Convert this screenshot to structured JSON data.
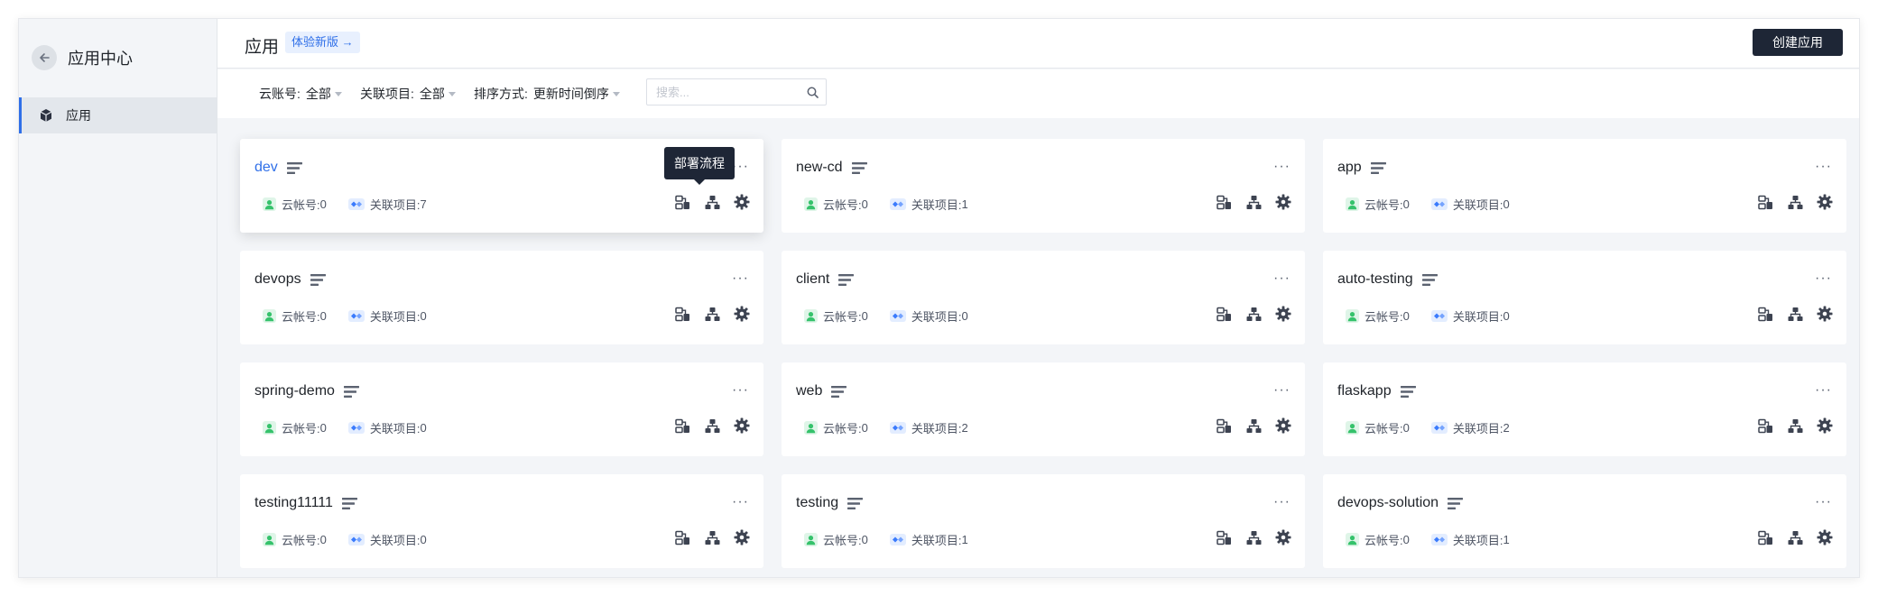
{
  "sidebar": {
    "title": "应用中心",
    "items": [
      {
        "label": "应用"
      }
    ]
  },
  "header": {
    "title": "应用",
    "badge": "体验新版 →",
    "create_button": "创建应用"
  },
  "filters": {
    "account": {
      "label": "云账号:",
      "value": "全部"
    },
    "project": {
      "label": "关联项目:",
      "value": "全部"
    },
    "sort": {
      "label": "排序方式:",
      "value": "更新时间倒序"
    },
    "search_placeholder": "搜索..."
  },
  "tooltip": "部署流程",
  "meta_labels": {
    "account": "云帐号:",
    "project": "关联项目:"
  },
  "apps": [
    {
      "name": "dev",
      "accounts": "0",
      "projects": "7"
    },
    {
      "name": "new-cd",
      "accounts": "0",
      "projects": "1"
    },
    {
      "name": "app",
      "accounts": "0",
      "projects": "0"
    },
    {
      "name": "devops",
      "accounts": "0",
      "projects": "0"
    },
    {
      "name": "client",
      "accounts": "0",
      "projects": "0"
    },
    {
      "name": "auto-testing",
      "accounts": "0",
      "projects": "0"
    },
    {
      "name": "spring-demo",
      "accounts": "0",
      "projects": "0"
    },
    {
      "name": "web",
      "accounts": "0",
      "projects": "2"
    },
    {
      "name": "flaskapp",
      "accounts": "0",
      "projects": "2"
    },
    {
      "name": "testing11111",
      "accounts": "0",
      "projects": "0"
    },
    {
      "name": "testing",
      "accounts": "0",
      "projects": "1"
    },
    {
      "name": "devops-solution",
      "accounts": "0",
      "projects": "1"
    }
  ],
  "colors": {
    "accent": "#2f6fe8",
    "dark_button": "#1e2636",
    "account_icon": "#35c26b",
    "project_icon": "#3a7bfd"
  }
}
